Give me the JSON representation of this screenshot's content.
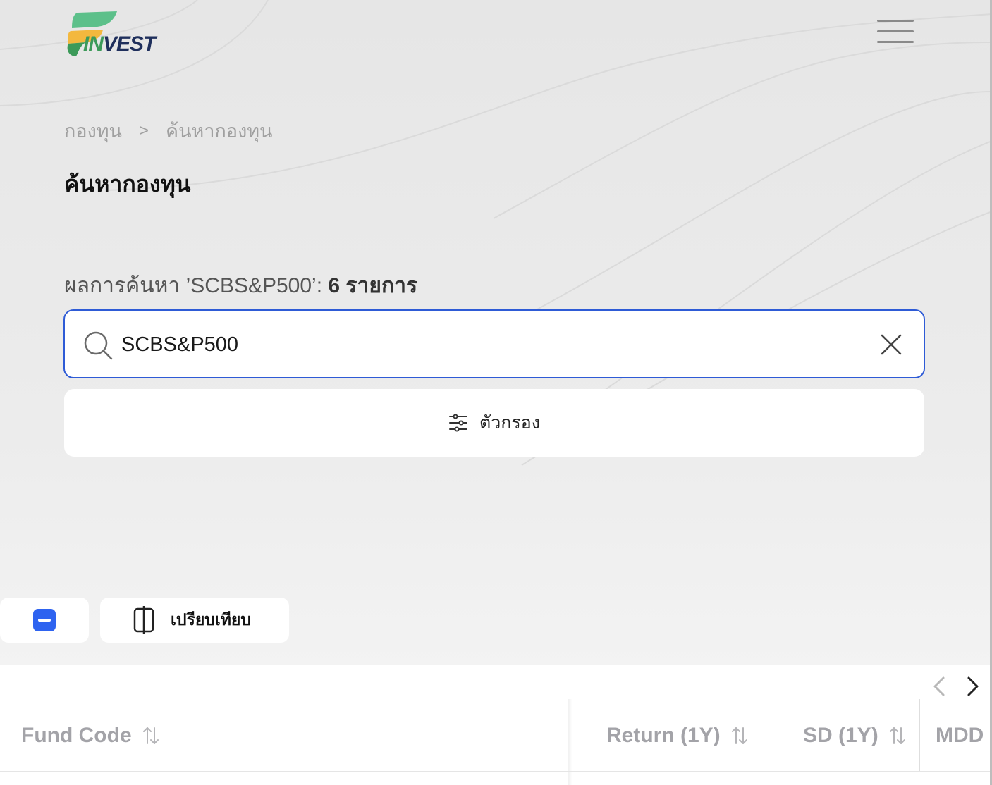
{
  "logo": {
    "text_in": "IN",
    "text_vest": "VEST"
  },
  "breadcrumb": {
    "items": [
      "กองทุน",
      "ค้นหากองทุน"
    ],
    "separator": ">"
  },
  "page_title": "ค้นหากองทุน",
  "result": {
    "prefix": "ผลการค้นหา ’SCBS&P500’: ",
    "count_text": "6 รายการ"
  },
  "search": {
    "value": "SCBS&P500",
    "placeholder": ""
  },
  "filter": {
    "label": "ตัวกรอง"
  },
  "toolbar": {
    "compare_label": "เปรียบเทียบ"
  },
  "table": {
    "columns": [
      "Fund Code",
      "Return (1Y)",
      "SD (1Y)",
      "MDD"
    ]
  },
  "colors": {
    "accent": "#2e5bd6",
    "checkbox": "#2e63f0",
    "logo_green": "#3c9a59",
    "logo_navy": "#1f2f5c",
    "logo_yellow": "#f3b83e"
  },
  "icons": [
    "menu-icon",
    "search-icon",
    "close-icon",
    "filter-sliders-icon",
    "compare-icon",
    "chevron-left-icon",
    "chevron-right-icon",
    "sort-icon"
  ]
}
